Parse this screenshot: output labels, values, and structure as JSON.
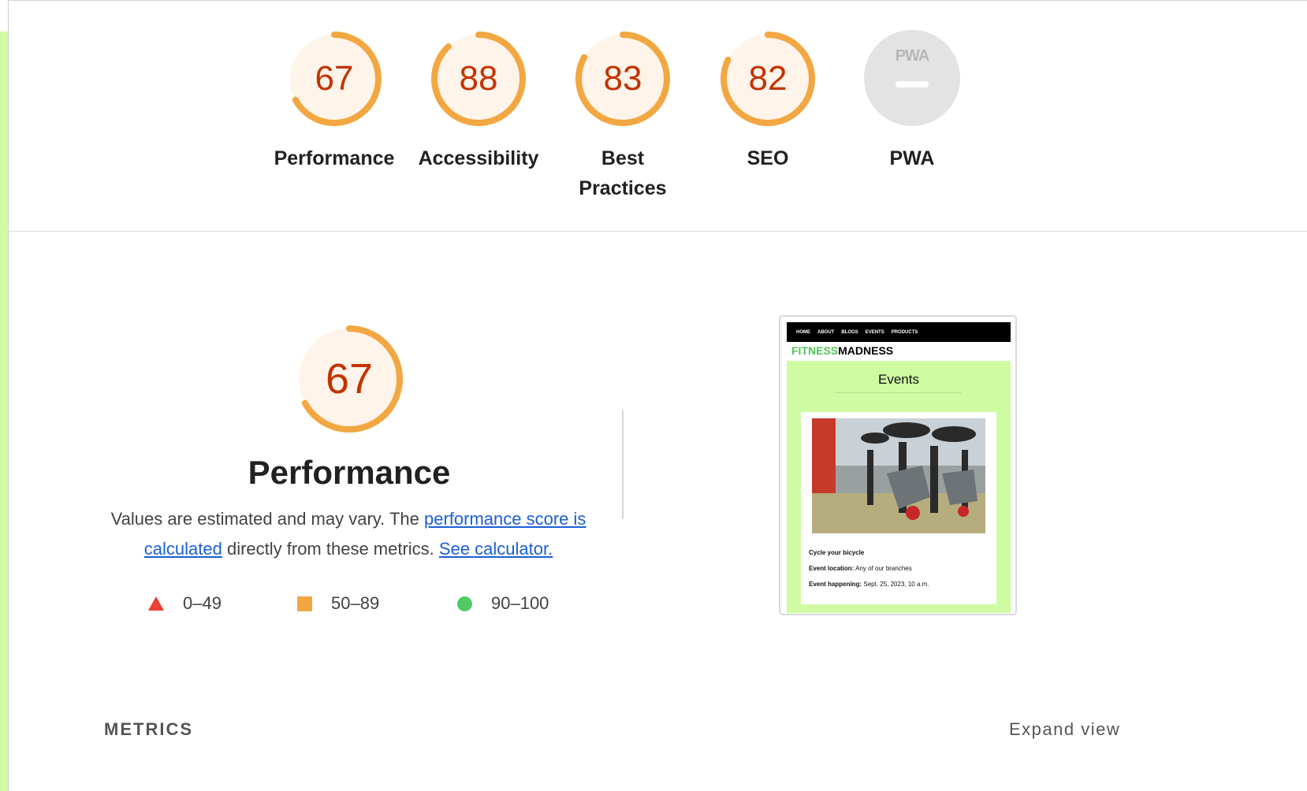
{
  "categories": [
    {
      "label": "Performance",
      "score": 67,
      "fraction": 0.67
    },
    {
      "label": "Accessibility",
      "score": 88,
      "fraction": 0.88
    },
    {
      "label": "Best Practices",
      "score": 83,
      "fraction": 0.83
    },
    {
      "label": "SEO",
      "score": 82,
      "fraction": 0.82
    },
    {
      "label": "PWA",
      "badge": "PWA"
    }
  ],
  "performance": {
    "score": 67,
    "fraction": 0.67,
    "title": "Performance",
    "desc_prefix": "Values are estimated and may vary. The ",
    "link_score": "performance score is calculated",
    "desc_mid": " directly from these metrics. ",
    "link_calculator": "See calculator."
  },
  "legend": [
    {
      "shape": "triangle",
      "range": "0–49",
      "color": "#eb4034"
    },
    {
      "shape": "square",
      "range": "50–89",
      "color": "#f2a742"
    },
    {
      "shape": "circle",
      "range": "90–100",
      "color": "#4fca65"
    }
  ],
  "colors": {
    "average_ring": "#f2a742",
    "average_fill": "#fef4e9",
    "average_text": "#c33300",
    "link": "#1a5fd6",
    "accent_green": "#cffca3"
  },
  "screenshot": {
    "nav": [
      "HOME",
      "ABOUT",
      "BLOGS",
      "EVENTS",
      "PRODUCTS"
    ],
    "brand_green": "FITNESS",
    "brand_black": "MADNESS",
    "heading": "Events",
    "event_title": "Cycle your bicycle",
    "location_label": "Event location:",
    "location_value": "Any of our branches",
    "happening_label": "Event happening:",
    "happening_value": "Sept. 25, 2023, 10 a.m."
  },
  "metrics_heading": "METRICS",
  "expand_label": "Expand view"
}
